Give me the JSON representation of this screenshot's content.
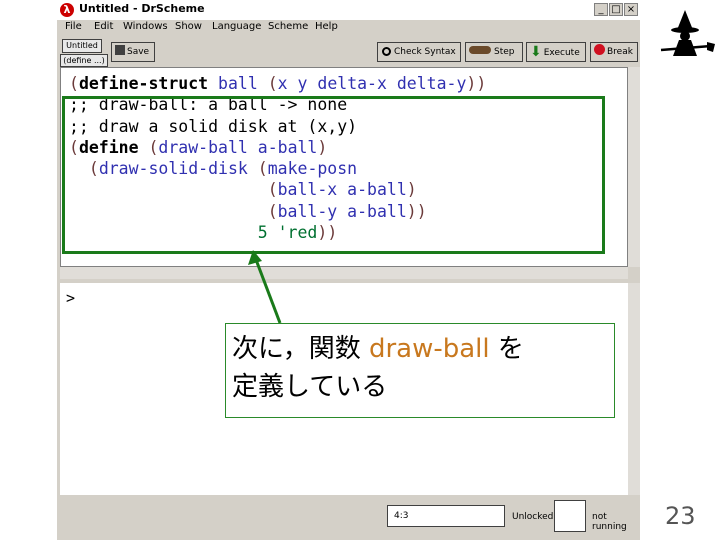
{
  "window": {
    "title": "Untitled - DrScheme",
    "controls": [
      "_",
      "□",
      "×"
    ]
  },
  "menubar": {
    "items": [
      "File",
      "Edit",
      "Windows",
      "Show",
      "Language",
      "Scheme",
      "Help"
    ]
  },
  "toolbar": {
    "filename": "Untitled",
    "define_label": "(define ...)",
    "save_label": "Save",
    "check_syntax_label": "Check Syntax",
    "step_label": "Step",
    "execute_label": "Execute",
    "break_label": "Break"
  },
  "definitions": {
    "lines": [
      "(define-struct ball (x y delta-x delta-y))",
      ";; draw-ball: a ball -> none",
      ";; draw a solid disk at (x,y)",
      "(define (draw-ball a-ball)",
      "  (draw-solid-disk (make-posn",
      "                    (ball-x a-ball)",
      "                    (ball-y a-ball))",
      "                   5 'red))"
    ]
  },
  "repl": {
    "prompt": ">"
  },
  "status": {
    "position": "4:3",
    "lock": "Unlocked",
    "run_state": "not running"
  },
  "annotation": {
    "line1_jp": "次に，関数 ",
    "line1_code": "draw-ball",
    "line1_tail": " を",
    "line2": "定義している"
  },
  "slide": {
    "page_number": "23"
  },
  "colors": {
    "highlight": "#1a7a1a",
    "keyword_orange": "#c8781e",
    "identifier": "#3030b0"
  }
}
